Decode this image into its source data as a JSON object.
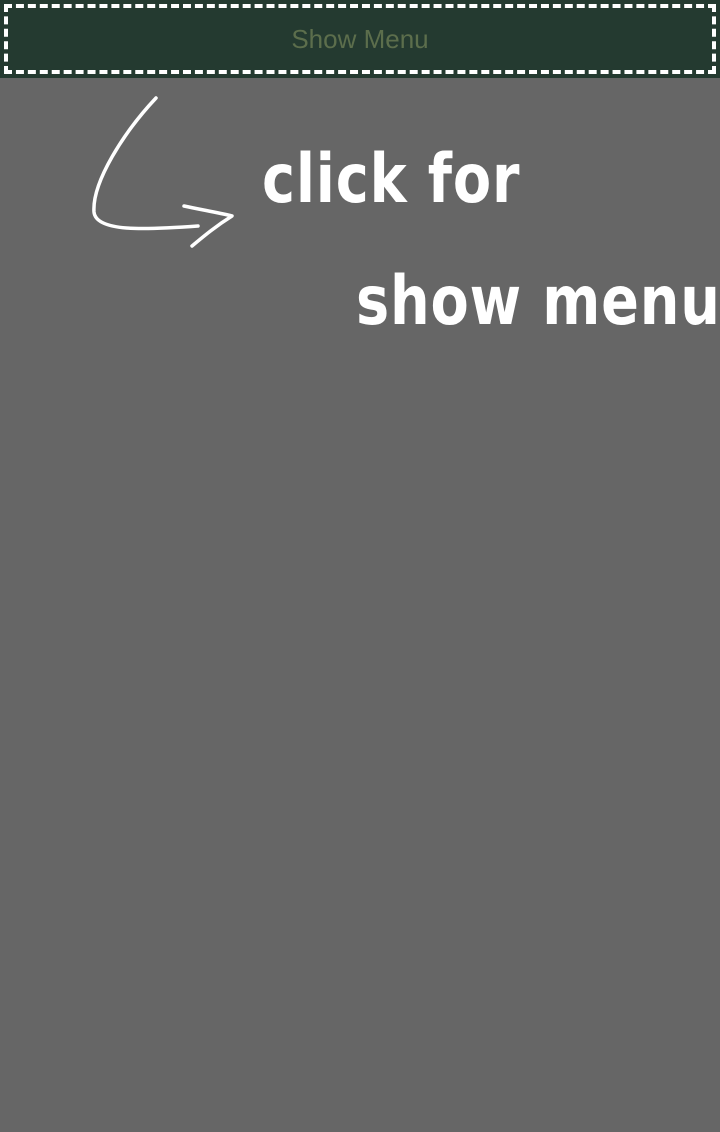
{
  "header": {
    "show_menu_label": "Show Menu"
  },
  "hint": {
    "line1": "click for",
    "line2": "show menu",
    "arrow_icon": "curved-arrow-right-icon"
  },
  "colors": {
    "background": "#666666",
    "header_bg": "#243a30",
    "header_text": "#5c6e4c",
    "dash_border": "#ffffff",
    "hint_text": "#ffffff"
  }
}
